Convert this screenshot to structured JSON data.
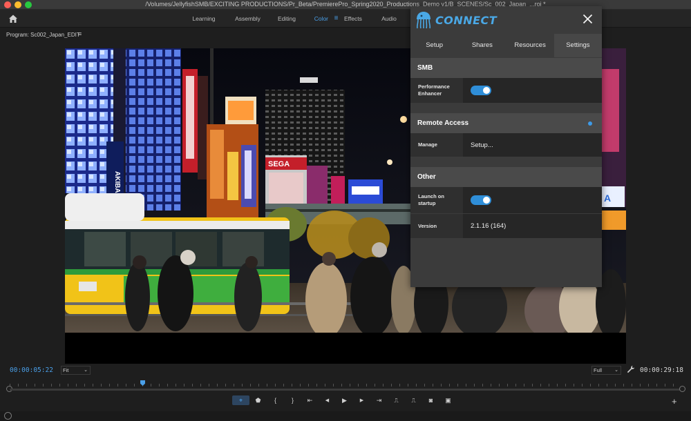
{
  "window": {
    "title": "/Volumes/JellyfishSMB/EXCITING PRODUCTIONS/Pr_Beta/PremierePro_Spring2020_Productions_Demo v1/B_SCENES/Sc_002_Japan_...roj *"
  },
  "workspace": {
    "tabs": [
      {
        "label": "Learning"
      },
      {
        "label": "Assembly"
      },
      {
        "label": "Editing"
      },
      {
        "label": "Color"
      },
      {
        "label": "Effects"
      },
      {
        "label": "Audio"
      }
    ],
    "active_tab": "Color"
  },
  "program": {
    "label": "Program: Sc002_Japan_EDIT",
    "menu_icon": "hamburger-icon"
  },
  "video": {
    "description_signs": [
      "Step Bus",
      "AKIBA",
      "SEGA"
    ]
  },
  "controls": {
    "timecode_current": "00:00:05:22",
    "timecode_total": "00:00:29:18",
    "fit_label": "Fit",
    "full_label": "Full",
    "playhead_fraction": 0.195,
    "transport": [
      {
        "name": "add-marker-icon",
        "glyph": "⌖"
      },
      {
        "name": "marker-icon",
        "glyph": "⬟"
      },
      {
        "name": "mark-in-icon",
        "glyph": "{"
      },
      {
        "name": "mark-out-icon",
        "glyph": "}"
      },
      {
        "name": "go-to-in-icon",
        "glyph": "⇤"
      },
      {
        "name": "step-back-icon",
        "glyph": "◀"
      },
      {
        "name": "play-icon",
        "glyph": "▶"
      },
      {
        "name": "step-forward-icon",
        "glyph": "▶"
      },
      {
        "name": "go-to-out-icon",
        "glyph": "⇥"
      },
      {
        "name": "lift-icon",
        "glyph": "⎍"
      },
      {
        "name": "extract-icon",
        "glyph": "⎍"
      },
      {
        "name": "export-frame-icon",
        "glyph": "◙"
      },
      {
        "name": "compare-view-icon",
        "glyph": "▣"
      }
    ]
  },
  "connect": {
    "title": "CONNECT",
    "tabs": [
      {
        "label": "Setup"
      },
      {
        "label": "Shares"
      },
      {
        "label": "Resources"
      },
      {
        "label": "Settings"
      }
    ],
    "active_tab": "Settings",
    "sections": {
      "smb": {
        "title": "SMB",
        "performance_label_1": "Performance",
        "performance_label_2": "Enhancer",
        "performance_enabled": true
      },
      "remote": {
        "title": "Remote Access",
        "manage_label": "Manage",
        "manage_value": "Setup..."
      },
      "other": {
        "title": "Other",
        "launch_label_1": "Launch on",
        "launch_label_2": "startup",
        "launch_enabled": true,
        "version_label": "Version",
        "version_value": "2.1.16 (164)"
      }
    },
    "accent_color": "#2f8ed8"
  }
}
